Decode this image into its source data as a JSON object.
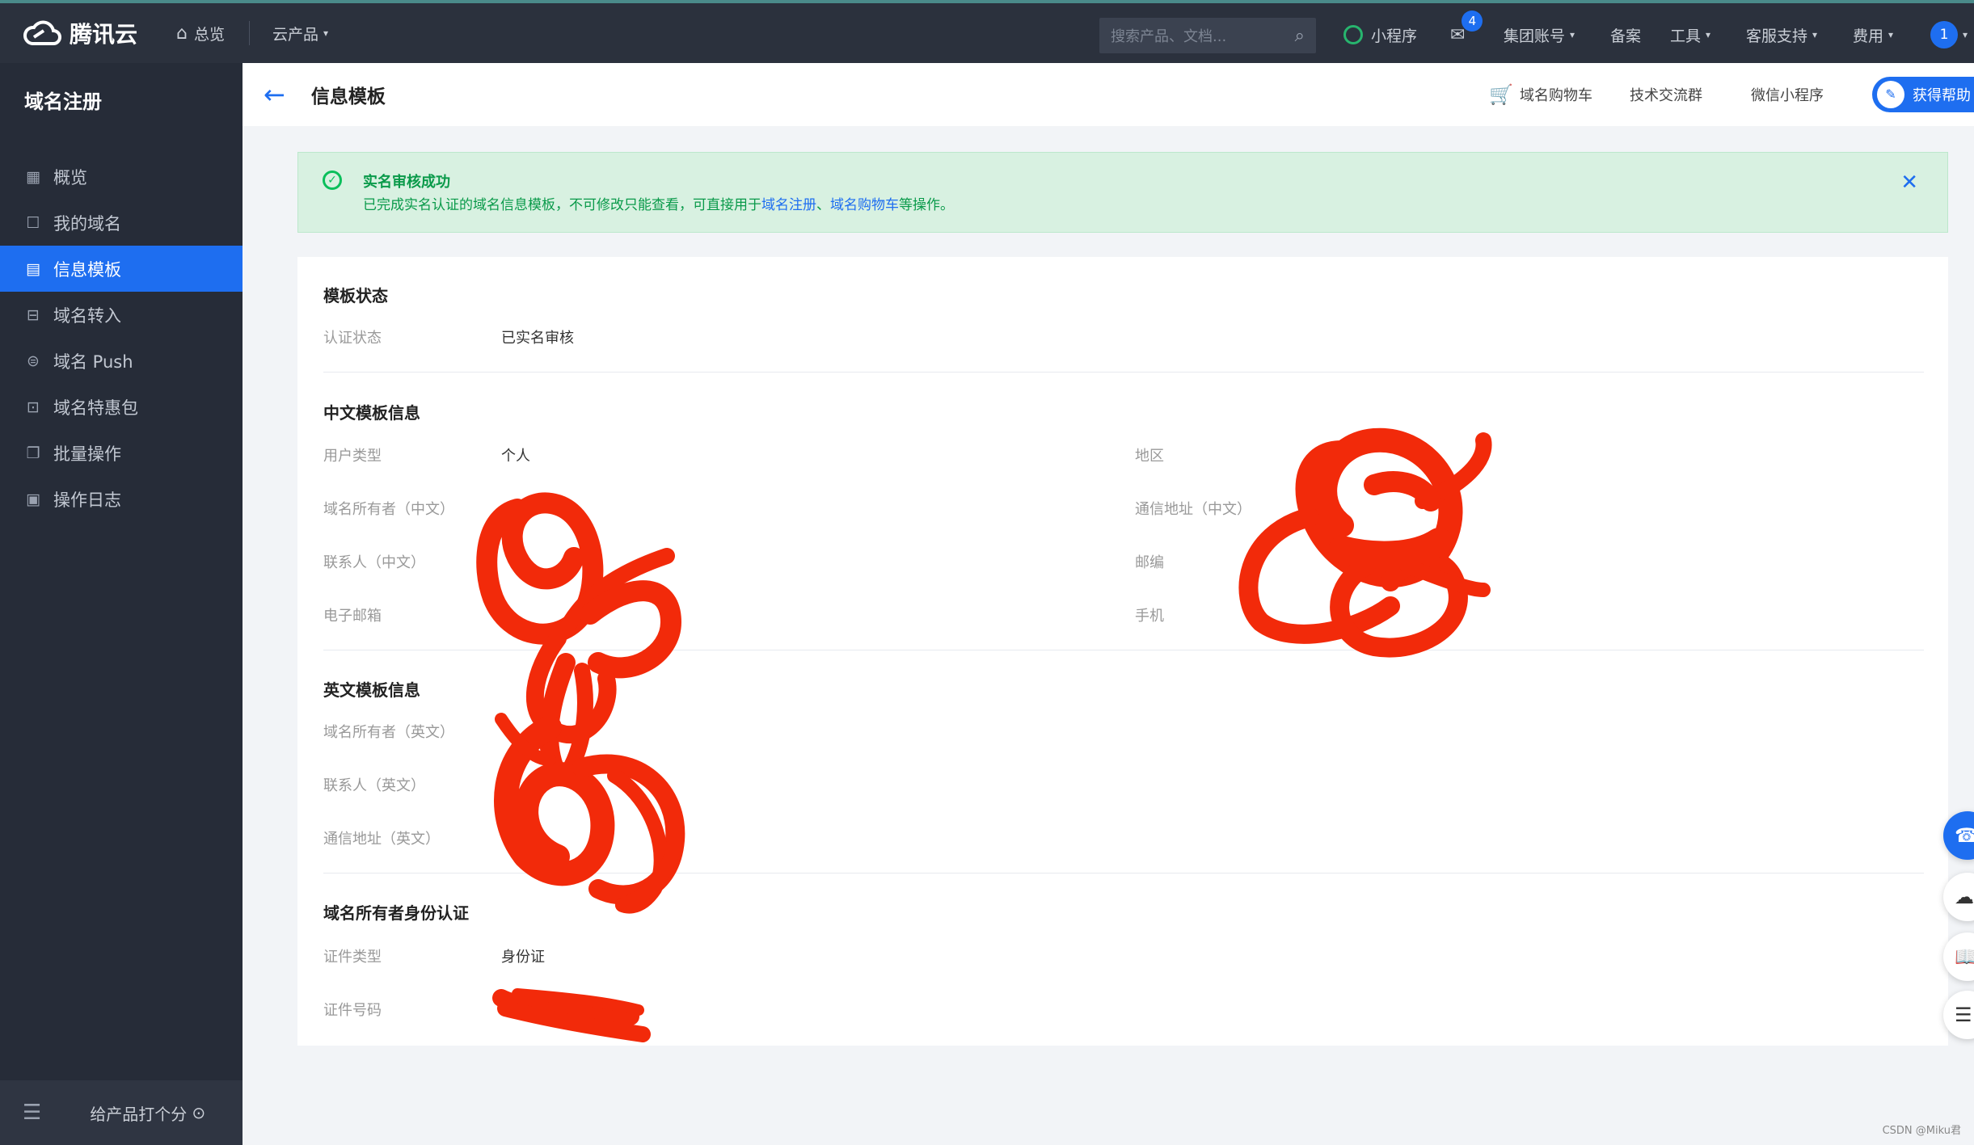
{
  "topbar": {
    "brand": "腾讯云",
    "home": "总览",
    "products": "云产品",
    "search_placeholder": "搜索产品、文档...",
    "mini_program": "小程序",
    "mail_badge": "4",
    "group_account": "集团账号",
    "beian": "备案",
    "tools": "工具",
    "support": "客服支持",
    "billing": "费用",
    "avatar": "1"
  },
  "sidebar": {
    "title": "域名注册",
    "items": [
      {
        "label": "概览",
        "icon": "grid-icon"
      },
      {
        "label": "我的域名",
        "icon": "square-icon"
      },
      {
        "label": "信息模板",
        "icon": "document-icon"
      },
      {
        "label": "域名转入",
        "icon": "transfer-icon"
      },
      {
        "label": "域名 Push",
        "icon": "push-icon"
      },
      {
        "label": "域名特惠包",
        "icon": "gift-icon"
      },
      {
        "label": "批量操作",
        "icon": "copy-icon"
      },
      {
        "label": "操作日志",
        "icon": "calendar-icon"
      }
    ],
    "active_index": 2,
    "rate_label": "给产品打个分"
  },
  "header": {
    "title": "信息模板",
    "cart": "域名购物车",
    "tech_group": "技术交流群",
    "wechat_mini": "微信小程序",
    "help": "获得帮助"
  },
  "alert": {
    "title": "实名审核成功",
    "desc_pre": "已完成实名认证的域名信息模板，不可修改只能查看，可直接用于",
    "link1": "域名注册",
    "sep": "、",
    "link2": "域名购物车",
    "desc_post": "等操作。"
  },
  "status_section": {
    "title": "模板状态",
    "label": "认证状态",
    "value": "已实名审核"
  },
  "cn_section": {
    "title": "中文模板信息",
    "user_type_label": "用户类型",
    "user_type_value": "个人",
    "owner_label": "域名所有者（中文）",
    "contact_label": "联系人（中文）",
    "email_label": "电子邮箱",
    "region_label": "地区",
    "address_label": "通信地址（中文）",
    "zip_label": "邮编",
    "phone_label": "手机"
  },
  "en_section": {
    "title": "英文模板信息",
    "owner_label": "域名所有者（英文）",
    "contact_label": "联系人（英文）",
    "address_label": "通信地址（英文）"
  },
  "id_section": {
    "title": "域名所有者身份认证",
    "id_type_label": "证件类型",
    "id_type_value": "身份证",
    "id_number_label": "证件号码"
  },
  "watermark": "CSDN @Miku君",
  "colors": {
    "accent": "#1e6ef0",
    "success": "#0abf5b",
    "redaction": "#f22a0a",
    "topbar": "#2b313d",
    "sidebar": "#262c38"
  }
}
